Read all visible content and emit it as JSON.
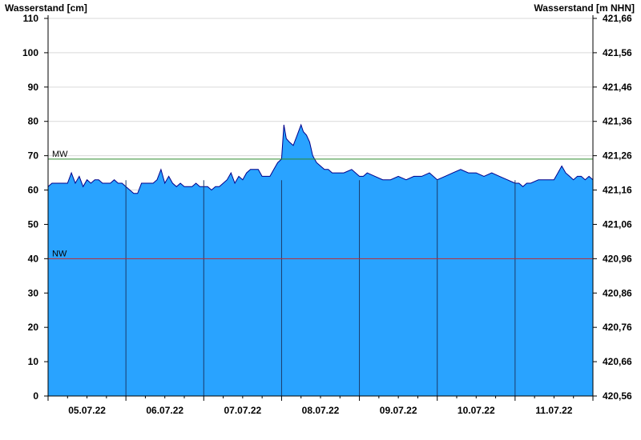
{
  "chart_data": {
    "type": "area",
    "ylabel_left": "Wasserstand [cm]",
    "ylabel_right": "Wasserstand [m NHN]",
    "ylim": [
      0,
      110
    ],
    "y_ticks_left": [
      0,
      10,
      20,
      30,
      40,
      50,
      60,
      70,
      80,
      90,
      100,
      110
    ],
    "y_ticks_right": [
      "420,56",
      "420,66",
      "420,76",
      "420,86",
      "420,96",
      "421,06",
      "421,16",
      "421,26",
      "421,36",
      "421,46",
      "421,56",
      "421,66"
    ],
    "x_tick_labels": [
      "05.07.22",
      "06.07.22",
      "07.07.22",
      "08.07.22",
      "09.07.22",
      "10.07.22",
      "11.07.22"
    ],
    "x_range_days": [
      0,
      7
    ],
    "day_divider_positions": [
      1,
      2,
      3,
      4,
      5,
      6
    ],
    "reference_lines": [
      {
        "label": "MW",
        "value": 69,
        "color": "#2e8b2e"
      },
      {
        "label": "NW",
        "value": 40,
        "color": "#c0282d"
      }
    ],
    "fill_color": "#29a3ff",
    "line_color": "#00008b",
    "grid": true,
    "series": [
      {
        "x": [
          0,
          0.05,
          0.1,
          0.15,
          0.2,
          0.25,
          0.3,
          0.35,
          0.4,
          0.45,
          0.5,
          0.55,
          0.6,
          0.65,
          0.7,
          0.75,
          0.8,
          0.85,
          0.9,
          0.95,
          1.0,
          1.05,
          1.1,
          1.15,
          1.2,
          1.25,
          1.3,
          1.35,
          1.4,
          1.45,
          1.5,
          1.55,
          1.6,
          1.65,
          1.7,
          1.75,
          1.8,
          1.85,
          1.9,
          1.95,
          2.0,
          2.05,
          2.1,
          2.15,
          2.2,
          2.25,
          2.3,
          2.35,
          2.4,
          2.45,
          2.5,
          2.55,
          2.6,
          2.65,
          2.7,
          2.75,
          2.8,
          2.85,
          2.9,
          2.95,
          3.0,
          3.03,
          3.06,
          3.1,
          3.15,
          3.2,
          3.25,
          3.28,
          3.32,
          3.36,
          3.4,
          3.45,
          3.5,
          3.55,
          3.6,
          3.65,
          3.7,
          3.75,
          3.8,
          3.9,
          4.0,
          4.05,
          4.1,
          4.2,
          4.3,
          4.4,
          4.5,
          4.6,
          4.7,
          4.8,
          4.9,
          5.0,
          5.1,
          5.2,
          5.3,
          5.4,
          5.5,
          5.6,
          5.7,
          5.8,
          5.9,
          6.0,
          6.05,
          6.1,
          6.15,
          6.2,
          6.3,
          6.4,
          6.5,
          6.55,
          6.6,
          6.65,
          6.7,
          6.75,
          6.8,
          6.85,
          6.9,
          6.95,
          7.0
        ],
        "y": [
          61,
          62,
          62,
          62,
          62,
          62,
          65,
          62,
          64,
          61,
          63,
          62,
          63,
          63,
          62,
          62,
          62,
          63,
          62,
          62,
          61,
          60,
          59,
          59,
          62,
          62,
          62,
          62,
          63,
          66,
          62,
          64,
          62,
          61,
          62,
          61,
          61,
          61,
          62,
          61,
          61,
          61,
          60,
          61,
          61,
          62,
          63,
          65,
          62,
          64,
          63,
          65,
          66,
          66,
          66,
          64,
          64,
          64,
          66,
          68,
          69,
          79,
          75,
          74,
          73,
          76,
          79,
          77,
          76,
          74,
          70,
          68,
          67,
          66,
          66,
          65,
          65,
          65,
          65,
          66,
          64,
          64,
          65,
          64,
          63,
          63,
          64,
          63,
          64,
          64,
          65,
          63,
          64,
          65,
          66,
          65,
          65,
          64,
          65,
          64,
          63,
          62,
          62,
          61,
          62,
          62,
          63,
          63,
          63,
          65,
          67,
          65,
          64,
          63,
          64,
          64,
          63,
          64,
          63
        ]
      }
    ]
  }
}
